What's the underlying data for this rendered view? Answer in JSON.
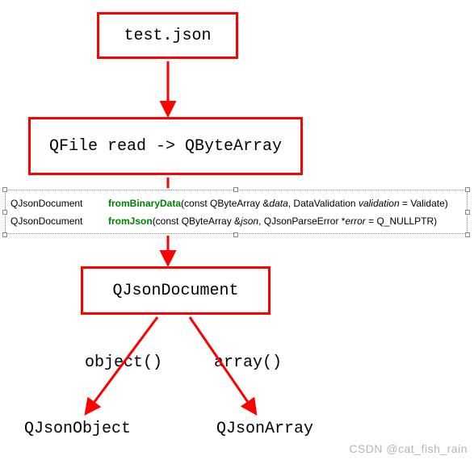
{
  "nodes": {
    "file": "test.json",
    "qfile": "QFile read -> QByteArray",
    "doc": "QJsonDocument",
    "obj": "QJsonObject",
    "arr": "QJsonArray"
  },
  "edges": {
    "object_method": "object()",
    "array_method": "array()"
  },
  "api": {
    "row1": {
      "ret": "QJsonDocument",
      "name": "fromBinaryData",
      "args_prefix": "(const QByteArray &",
      "args_i1": "data",
      "args_mid": ", DataValidation ",
      "args_i2": "validation",
      "args_suffix": " = Validate)"
    },
    "row2": {
      "ret": "QJsonDocument",
      "name": "fromJson",
      "args_prefix": "(const QByteArray &",
      "args_i1": "json",
      "args_mid": ", QJsonParseError *",
      "args_i2": "error",
      "args_suffix": " = Q_NULLPTR)"
    }
  },
  "watermark": "CSDN @cat_fish_rain"
}
